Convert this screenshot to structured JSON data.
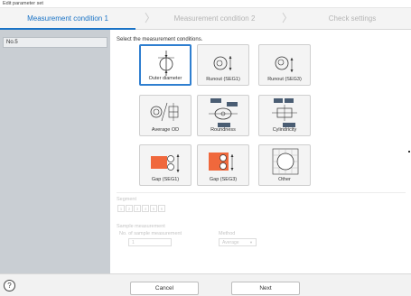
{
  "window": {
    "title": "Edit parameter set"
  },
  "steps": [
    {
      "label": "Measurement condition 1",
      "active": true
    },
    {
      "label": "Measurement condition 2",
      "active": false
    },
    {
      "label": "Check settings",
      "active": false
    }
  ],
  "sidebar": {
    "items": [
      {
        "label": "No.5"
      }
    ]
  },
  "main": {
    "instruction": "Select the measurement conditions.",
    "tiles": [
      {
        "label": "Outer diameter",
        "icon": "outer-diameter-icon",
        "selected": true
      },
      {
        "label": "Runout (SEG1)",
        "icon": "runout-seg1-icon",
        "selected": false
      },
      {
        "label": "Runout (SEG3)",
        "icon": "runout-seg3-icon",
        "selected": false
      },
      {
        "label": "Average OD",
        "icon": "average-od-icon",
        "selected": false
      },
      {
        "label": "Roundness",
        "icon": "roundness-icon",
        "selected": false
      },
      {
        "label": "Cylindricity",
        "icon": "cylindricity-icon",
        "selected": false
      },
      {
        "label": "Gap (SEG1)",
        "icon": "gap-seg1-icon",
        "selected": false
      },
      {
        "label": "Gap (SEG3)",
        "icon": "gap-seg3-icon",
        "selected": false
      },
      {
        "label": "Other",
        "icon": "other-icon",
        "selected": false
      }
    ],
    "segment": {
      "title": "Segment",
      "boxes": [
        "1",
        "2",
        "3",
        "4",
        "5",
        "6"
      ]
    },
    "sample": {
      "title": "Sample measurement",
      "count_label": "No. of sample measurement",
      "count_value": "1",
      "method_label": "Method",
      "method_value": "Average"
    }
  },
  "footer": {
    "help_symbol": "?",
    "cancel_label": "Cancel",
    "next_label": "Next"
  },
  "colors": {
    "accent": "#1a73c6",
    "sidebar": "#c9ced3",
    "orange": "#f0683c",
    "badge": "#4a5d73"
  }
}
